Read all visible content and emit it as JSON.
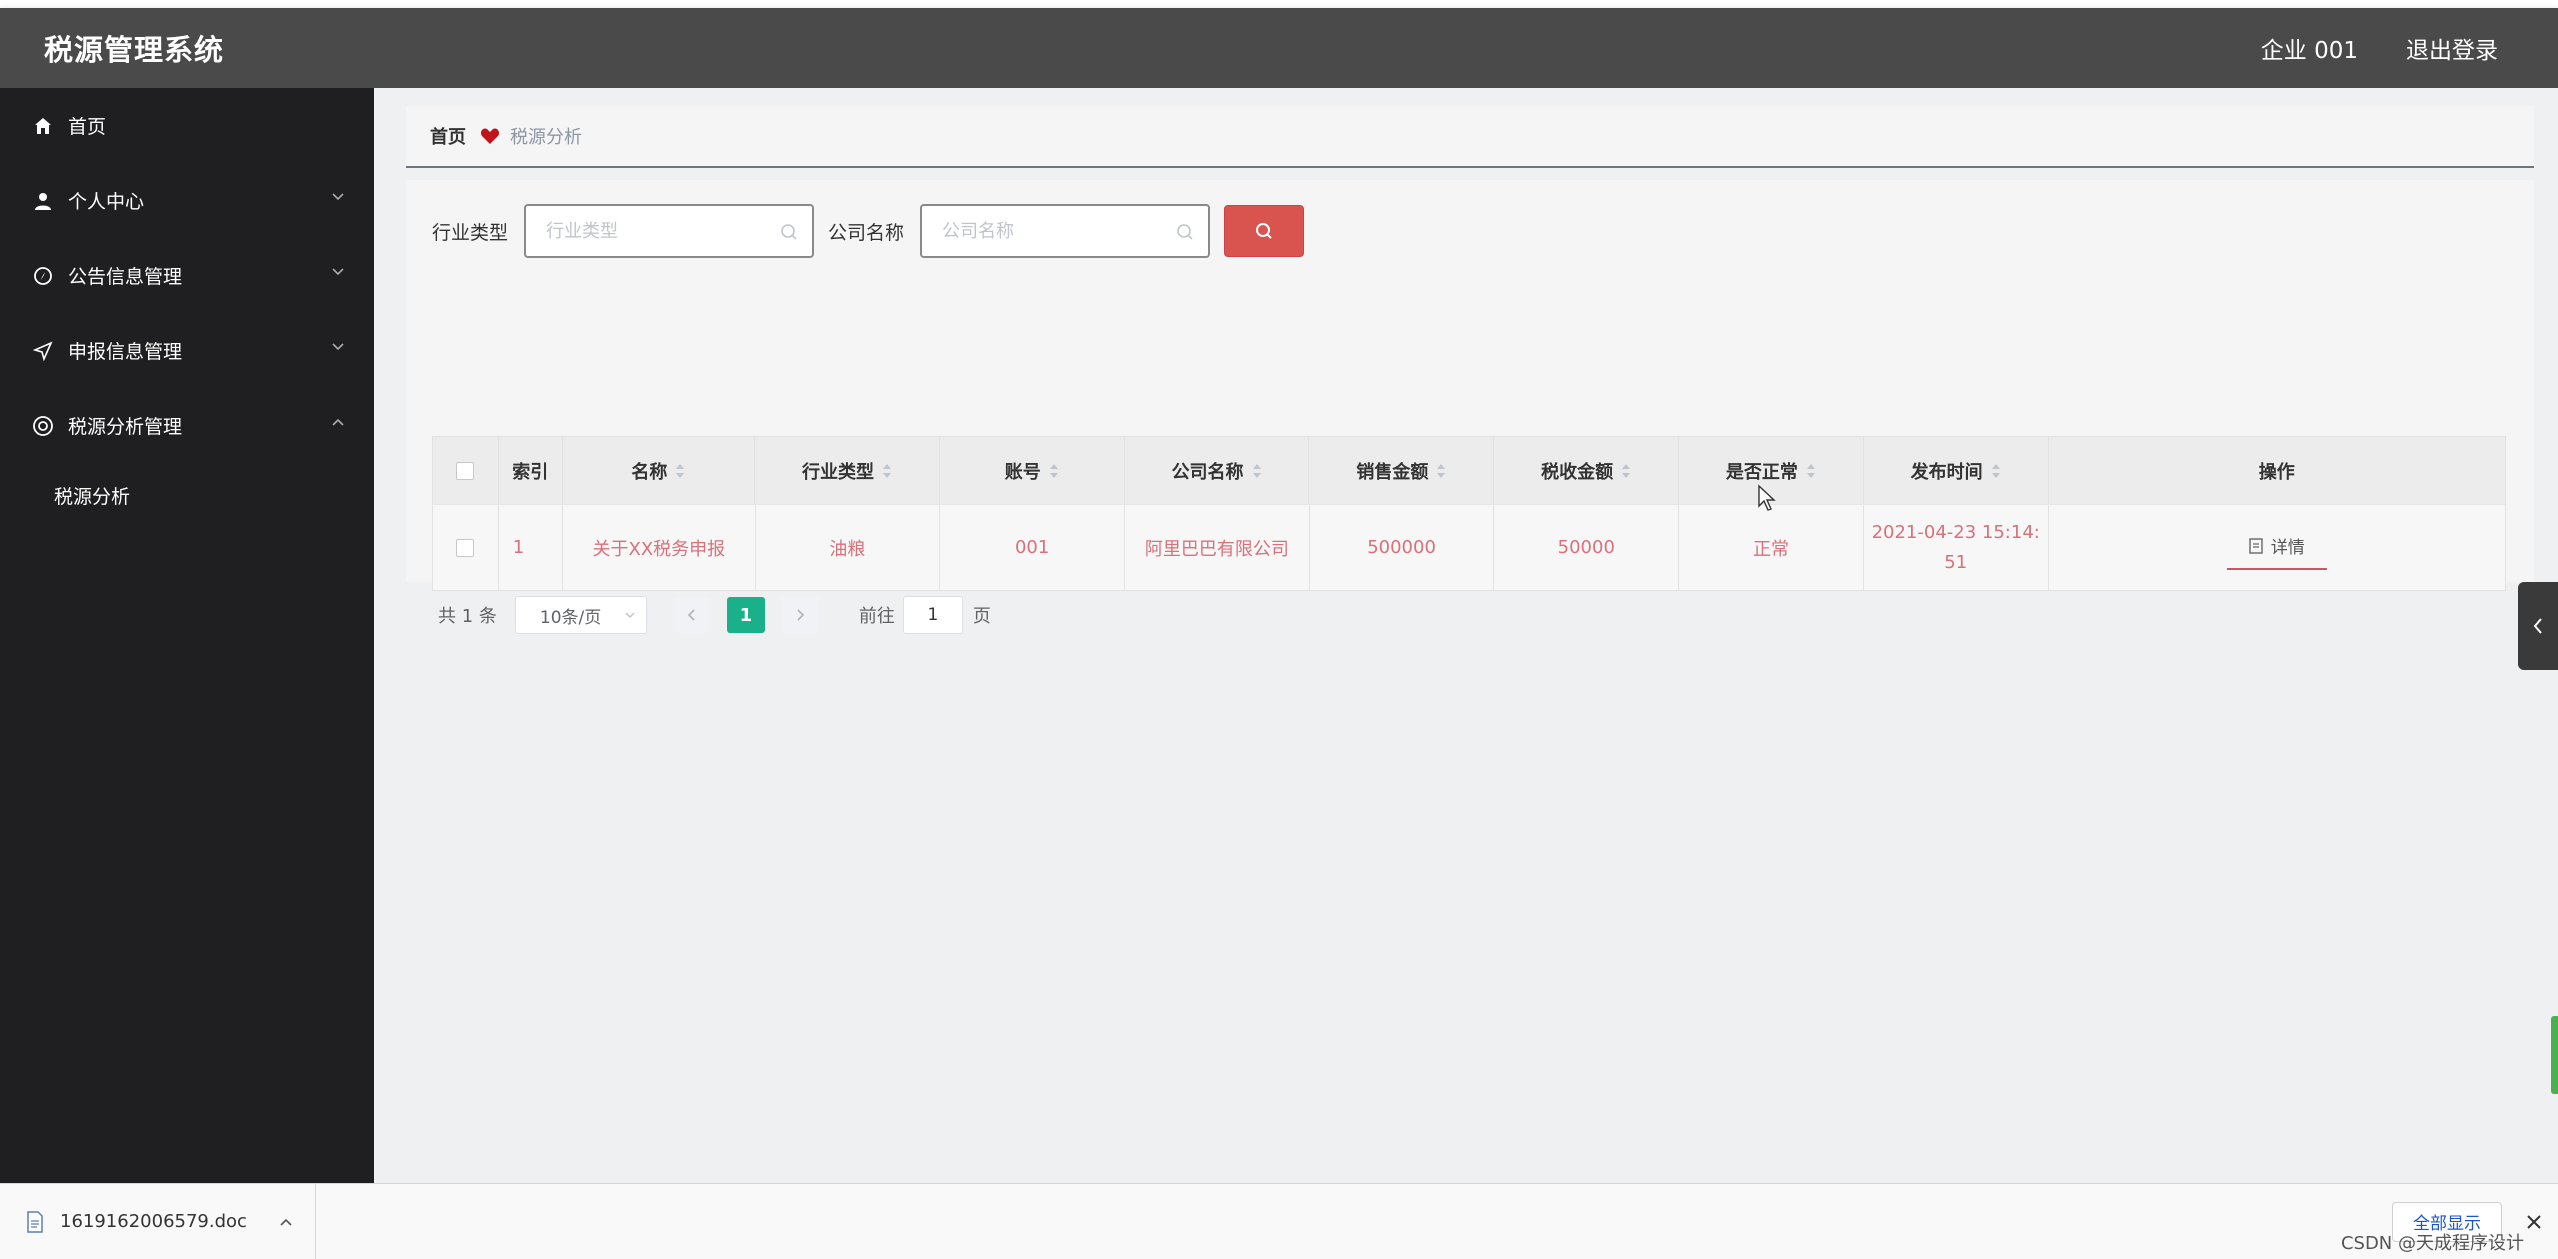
{
  "header": {
    "title": "税源管理系统",
    "user": "企业 001",
    "logout": "退出登录"
  },
  "sidebar": {
    "items": [
      {
        "label": "首页",
        "icon": "home-icon"
      },
      {
        "label": "个人中心",
        "icon": "user-icon"
      },
      {
        "label": "公告信息管理",
        "icon": "compass-icon"
      },
      {
        "label": "申报信息管理",
        "icon": "send-icon"
      },
      {
        "label": "税源分析管理",
        "icon": "lifebuoy-icon"
      }
    ],
    "subitems": [
      {
        "label": "税源分析"
      }
    ]
  },
  "breadcrumb": {
    "home": "首页",
    "current": "税源分析"
  },
  "search": {
    "industry_label": "行业类型",
    "industry_placeholder": "行业类型",
    "company_label": "公司名称",
    "company_placeholder": "公司名称"
  },
  "table": {
    "headers": [
      "索引",
      "名称",
      "行业类型",
      "账号",
      "公司名称",
      "销售金额",
      "税收金额",
      "是否正常",
      "发布时间",
      "操作"
    ],
    "rows": [
      {
        "index": "1",
        "name": "关于XX税务申报",
        "industry": "油粮",
        "account": "001",
        "company": "阿里巴巴有限公司",
        "sales": "500000",
        "tax": "50000",
        "normal": "正常",
        "time_line1": "2021-04-23 15:14:",
        "time_line2": "51",
        "action": "详情"
      }
    ]
  },
  "pager": {
    "total": "共 1 条",
    "page_size": "10条/页",
    "current_page": "1",
    "goto_label": "前往",
    "goto_value": "1",
    "page_unit": "页"
  },
  "download": {
    "file": "1619162006579.doc",
    "show_all": "全部显示"
  },
  "watermark": "CSDN @天成程序设计",
  "colors": {
    "accent": "#d9534f",
    "pager_active": "#19b08a",
    "row_text": "#d9717a"
  }
}
